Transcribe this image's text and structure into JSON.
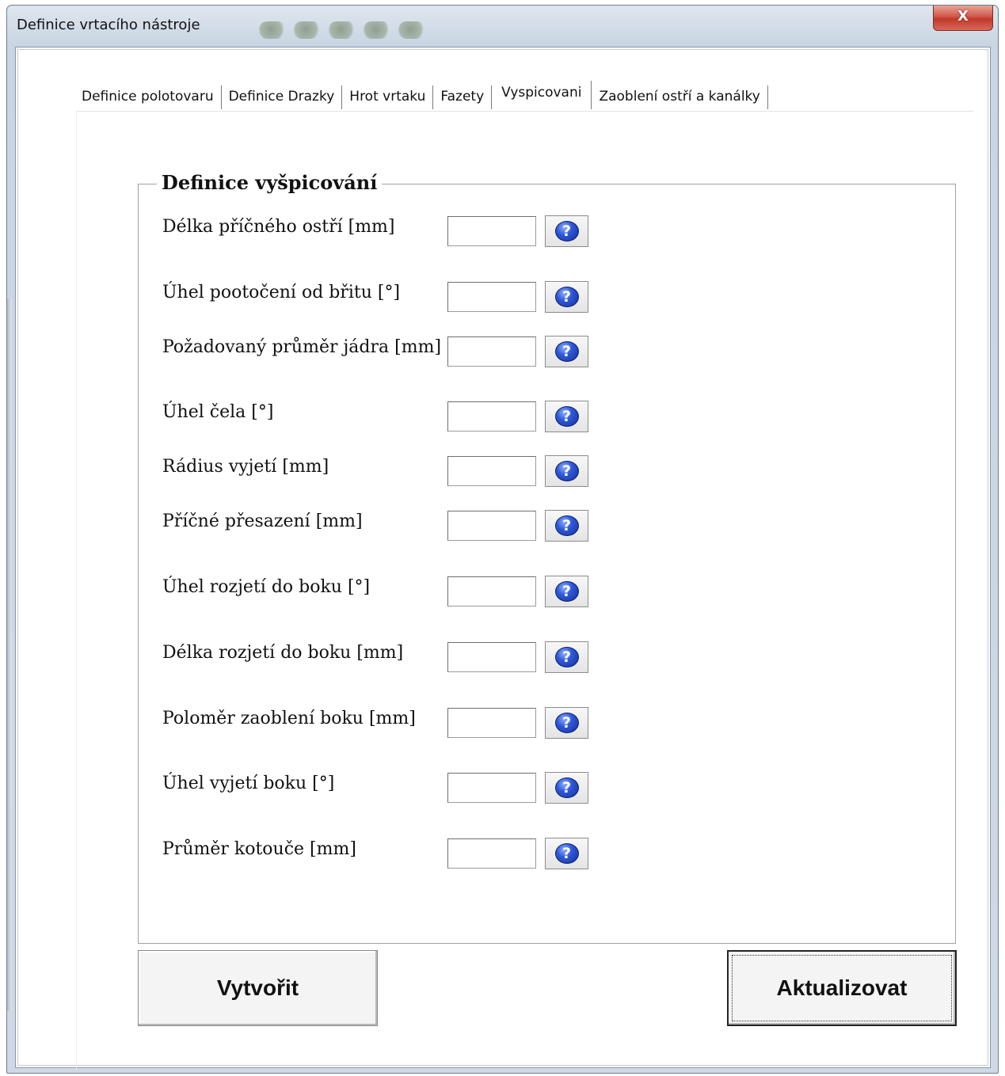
{
  "window": {
    "title": "Definice vrtacího nástroje",
    "close_label": "X"
  },
  "tabs": [
    {
      "label": "Definice polotovaru",
      "active": false
    },
    {
      "label": "Definice Drazky",
      "active": false
    },
    {
      "label": "Hrot vrtaku",
      "active": false
    },
    {
      "label": "Fazety",
      "active": false
    },
    {
      "label": "Vyspicovani",
      "active": true
    },
    {
      "label": "Zaoblení ostří a kanálky",
      "active": false
    }
  ],
  "group": {
    "title": "Definice vyšpicování"
  },
  "fields": [
    {
      "label": "Délka příčného ostří  [mm]",
      "value": ""
    },
    {
      "label": "Úhel pootočení od břitu [°]",
      "value": ""
    },
    {
      "label": "Požadovaný průměr jádra [mm]",
      "value": ""
    },
    {
      "label": "Úhel čela [°]",
      "value": ""
    },
    {
      "label": "Rádius vyjetí [mm]",
      "value": ""
    },
    {
      "label": "Příčné přesazení  [mm]",
      "value": ""
    },
    {
      "label": "Úhel rozjetí do boku  [°]",
      "value": ""
    },
    {
      "label": "Délka rozjetí do boku  [mm]",
      "value": ""
    },
    {
      "label": "Poloměr zaoblení boku  [mm]",
      "value": ""
    },
    {
      "label": "Úhel vyjetí boku  [°]",
      "value": ""
    },
    {
      "label": "Průměr kotouče [mm]",
      "value": ""
    }
  ],
  "help_button": {
    "glyph": "?",
    "icon": "help-question-icon",
    "color": "#2e58d8"
  },
  "buttons": {
    "create_label": "Vytvořit",
    "update_label": "Aktualizovat"
  }
}
